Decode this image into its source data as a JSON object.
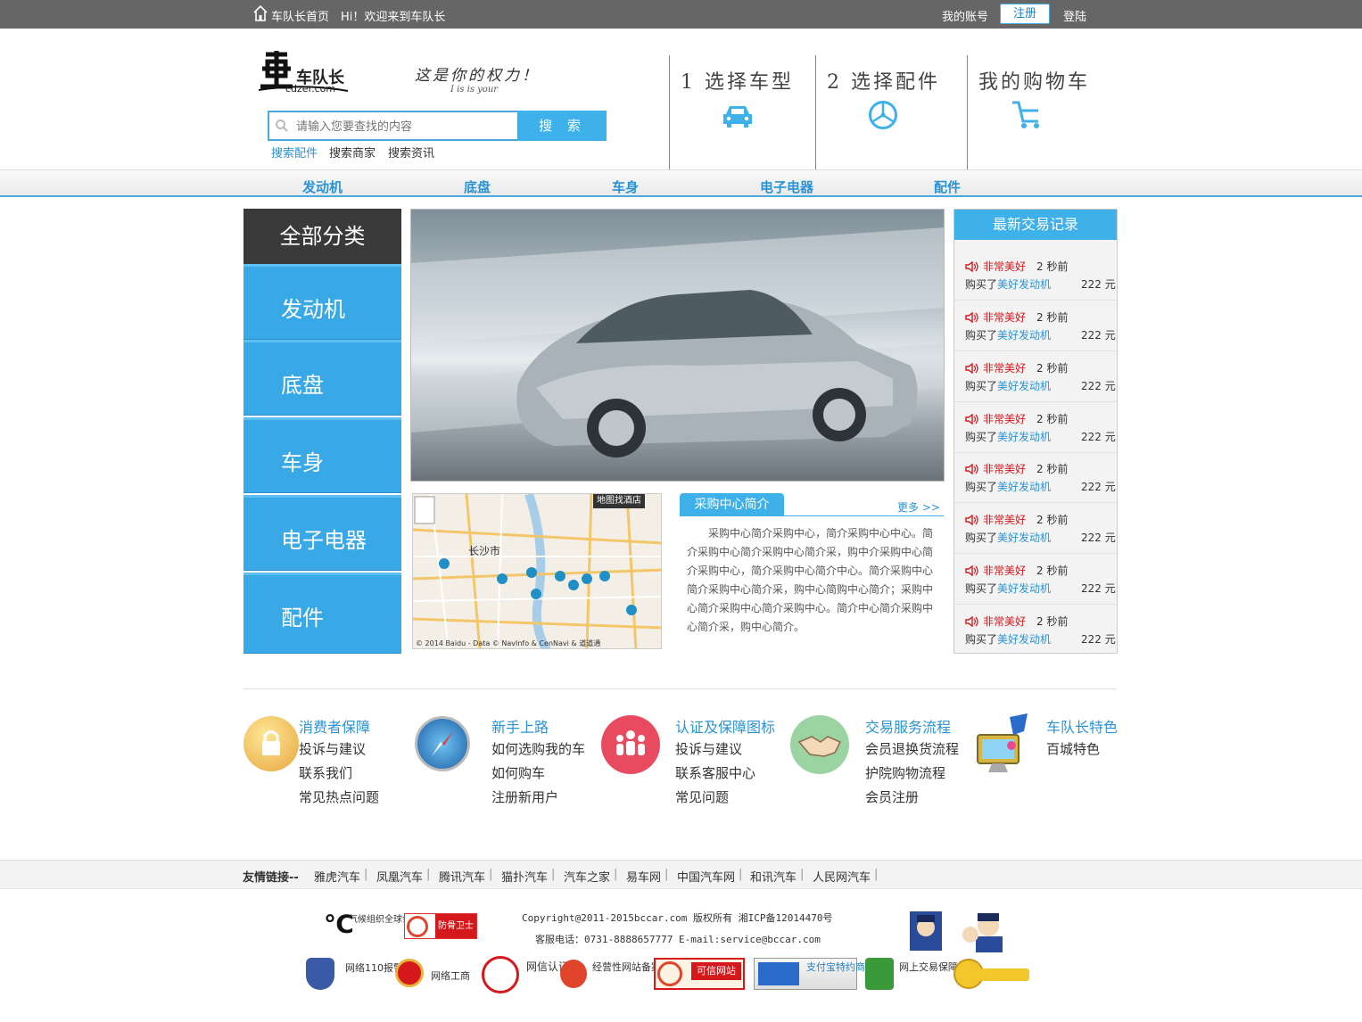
{
  "topbar": {
    "home": "车队长首页",
    "welcome": "Hi！欢迎来到车队长",
    "account": "我的账号",
    "register": "注册",
    "login": "登陆"
  },
  "header": {
    "logo_text": "车队长",
    "logo_domain": "cdzer.com",
    "slogan": "这是你的权力！",
    "slogan_en": "I is is your",
    "search_placeholder": "请输入您要查找的内容",
    "search_button": "搜 索",
    "search_tabs": [
      "搜索配件",
      "搜索商家",
      "搜索资讯"
    ],
    "steps": [
      "1 选择车型",
      "2 选择配件",
      "我的购物车"
    ]
  },
  "nav": [
    "发动机",
    "底盘",
    "车身",
    "电子电器",
    "配件"
  ],
  "sidebar": {
    "title": "全部分类",
    "items": [
      "发动机",
      "底盘",
      "车身",
      "电子电器",
      "配件"
    ]
  },
  "map": {
    "btn": "地图找酒店",
    "city": "长沙市",
    "credit": "© 2014 Baidu - Data © NavInfo & CenNavi & 道道通"
  },
  "intro": {
    "title": "采购中心简介",
    "more": "更多 >>",
    "text": "采购中心简介采购中心，简介采购中心中心。简介采购中心简介采购中心简介采，购中介采购中心简介采购中心，简介采购中心简介中心。简介采购中心简介采购中心简介采，购中心简购中心简介；采购中心简介采购中心简介采购中心。简介中心简介采购中心简介采，购中心简介。"
  },
  "transactions": {
    "title": "最新交易记录",
    "items": [
      {
        "user": "非常美好",
        "time": "2 秒前",
        "bought": "购买了",
        "product": "美好发动机",
        "price": "222 元"
      },
      {
        "user": "非常美好",
        "time": "2 秒前",
        "bought": "购买了",
        "product": "美好发动机",
        "price": "222 元"
      },
      {
        "user": "非常美好",
        "time": "2 秒前",
        "bought": "购买了",
        "product": "美好发动机",
        "price": "222 元"
      },
      {
        "user": "非常美好",
        "time": "2 秒前",
        "bought": "购买了",
        "product": "美好发动机",
        "price": "222 元"
      },
      {
        "user": "非常美好",
        "time": "2 秒前",
        "bought": "购买了",
        "product": "美好发动机",
        "price": "222 元"
      },
      {
        "user": "非常美好",
        "time": "2 秒前",
        "bought": "购买了",
        "product": "美好发动机",
        "price": "222 元"
      },
      {
        "user": "非常美好",
        "time": "2 秒前",
        "bought": "购买了",
        "product": "美好发动机",
        "price": "222 元"
      },
      {
        "user": "非常美好",
        "time": "2 秒前",
        "bought": "购买了",
        "product": "美好发动机",
        "price": "222 元"
      }
    ]
  },
  "services": [
    {
      "title": "消费者保障",
      "icon": "lock-icon",
      "links": [
        "投诉与建议",
        "联系我们",
        "常见热点问题"
      ]
    },
    {
      "title": "新手上路",
      "icon": "compass-icon",
      "links": [
        "如何选购我的车",
        "如何购车",
        "注册新用户"
      ]
    },
    {
      "title": "认证及保障图标",
      "icon": "users-icon",
      "links": [
        "投诉与建议",
        "联系客服中心",
        "常见问题"
      ]
    },
    {
      "title": "交易服务流程",
      "icon": "handshake-icon",
      "links": [
        "会员退换货流程",
        "护院购物流程",
        "会员注册"
      ]
    },
    {
      "title": "车队长特色",
      "icon": "computer-icon",
      "links": [
        "百城特色"
      ]
    }
  ],
  "friend_links": {
    "label": "友情链接--",
    "items": [
      "雅虎汽车",
      "凤凰汽车",
      "腾讯汽车",
      "猫扑汽车",
      "汽车之家",
      "易车网",
      "中国汽车网",
      "和讯汽车",
      "人民网汽车"
    ]
  },
  "footer": {
    "copyright": "Copyright@2011-2015bccar.com 版权所有 湘ICP备12014470号",
    "contact": "客服电话：0731-8888657777 E-mail:service@bccar.com",
    "badges_top": [
      "气候组织全球会员",
      "防骨卫士"
    ],
    "badges_bottom": [
      "网络110报警服务",
      "网络工商",
      "网信认证",
      "经营性网站备案信息",
      "可信网站",
      "支付宝特约商家",
      "网上交易保障中心"
    ]
  },
  "colors": {
    "accent": "#3eb0ea",
    "topbar": "#666666",
    "link_blue": "#2a93d5",
    "red": "#d4181b"
  }
}
